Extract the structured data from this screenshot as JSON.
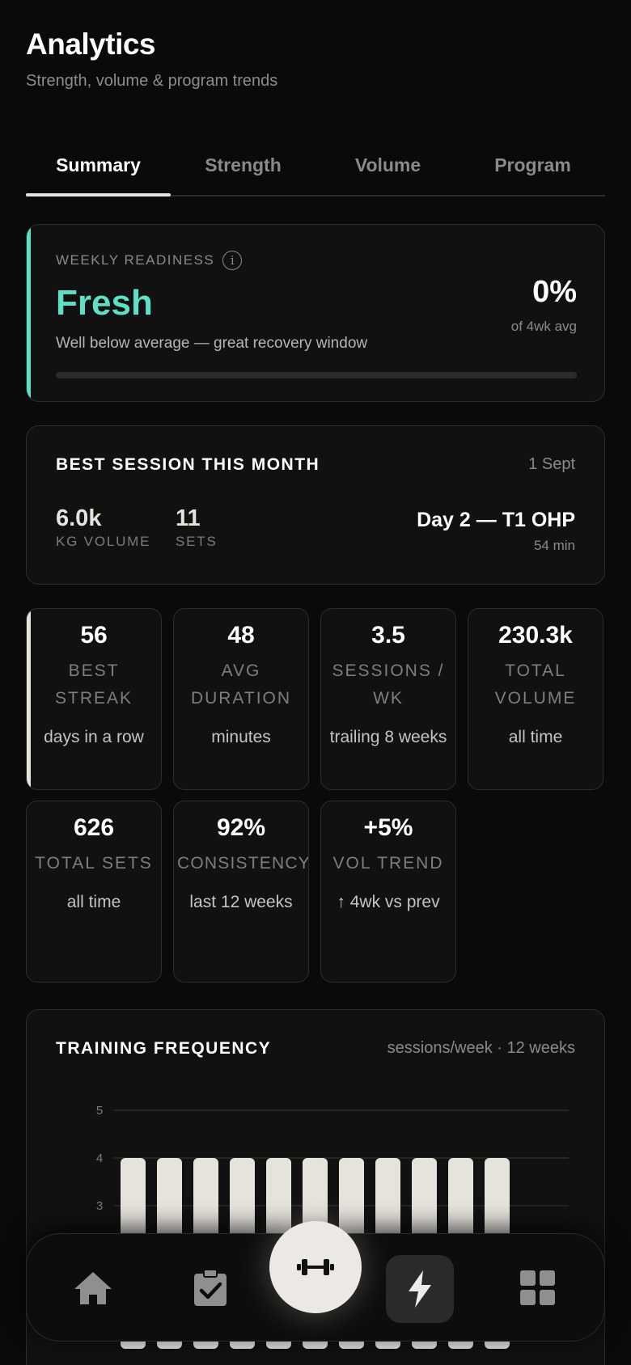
{
  "header": {
    "title": "Analytics",
    "subtitle": "Strength, volume & program trends"
  },
  "tabs": [
    {
      "label": "Summary",
      "active": true
    },
    {
      "label": "Strength",
      "active": false
    },
    {
      "label": "Volume",
      "active": false
    },
    {
      "label": "Program",
      "active": false
    }
  ],
  "readiness": {
    "label": "WEEKLY READINESS",
    "info_icon": "i",
    "status": "Fresh",
    "description": "Well below average — great recovery window",
    "percent": "0%",
    "percent_sub": "of 4wk avg",
    "progress_fraction": 0,
    "accent_color": "#5ee0c6"
  },
  "best_session": {
    "title": "BEST SESSION THIS MONTH",
    "date": "1 Sept",
    "volume_value": "6.0k",
    "volume_label": "KG VOLUME",
    "sets_value": "11",
    "sets_label": "SETS",
    "session_name": "Day 2 — T1 OHP",
    "duration": "54 min"
  },
  "stats": [
    {
      "value": "56",
      "label": "BEST STREAK",
      "sub": "days in a row",
      "highlighted": true
    },
    {
      "value": "48",
      "label": "AVG DURATION",
      "sub": "minutes"
    },
    {
      "value": "3.5",
      "label": "SESSIONS / WK",
      "sub": "trailing 8 weeks"
    },
    {
      "value": "230.3k",
      "label": "TOTAL VOLUME",
      "sub": "all time"
    },
    {
      "value": "626",
      "label": "TOTAL SETS",
      "sub": "all time"
    },
    {
      "value": "92%",
      "label": "CONSISTENCY",
      "sub": "last 12 weeks"
    },
    {
      "value": "+5%",
      "label": "VOL TREND",
      "sub": "↑ 4wk vs prev"
    }
  ],
  "frequency": {
    "title": "TRAINING FREQUENCY",
    "subtitle": "sessions/week · 12 weeks"
  },
  "chart_data": {
    "type": "bar",
    "title": "TRAINING FREQUENCY",
    "subtitle": "sessions/week · 12 weeks",
    "y_ticks": [
      "5",
      "4",
      "3"
    ],
    "ylim": [
      0,
      5
    ],
    "values": [
      4,
      4,
      4,
      4,
      4,
      4,
      4,
      4,
      4,
      4,
      4
    ],
    "grid": true,
    "bar_color": "#e6e2dc"
  },
  "nav": {
    "items": [
      {
        "icon": "home-icon"
      },
      {
        "icon": "clipboard-check-icon"
      },
      {
        "icon": "dumbbell-icon"
      },
      {
        "icon": "lightning-icon",
        "active": true
      },
      {
        "icon": "grid-icon"
      }
    ]
  }
}
